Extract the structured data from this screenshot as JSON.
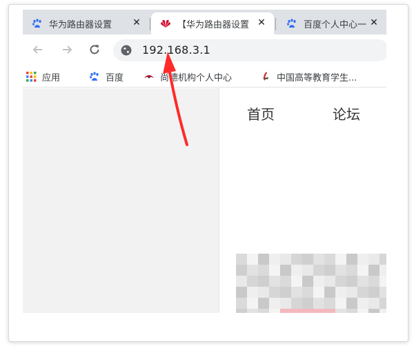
{
  "tabs": [
    {
      "title": "华为路由器设置",
      "icon": "baidu-paw-icon",
      "active": false
    },
    {
      "title": "【华为路由器设置",
      "icon": "huawei-logo-icon",
      "active": true
    },
    {
      "title": "百度个人中心一",
      "icon": "baidu-paw-icon",
      "active": false
    }
  ],
  "tab_close_glyph": "✕",
  "address_bar": {
    "url": "192.168.3.1",
    "icon": "globe-icon"
  },
  "bookmarks": [
    {
      "label": "应用",
      "icon": "apps-grid-icon"
    },
    {
      "label": "百度",
      "icon": "baidu-paw-icon"
    },
    {
      "label": "尚德机构个人中心",
      "icon": "sunlands-logo-icon"
    },
    {
      "label": "中国高等教育学生...",
      "icon": "chsi-logo-icon"
    }
  ],
  "page": {
    "nav": [
      {
        "label": "首页"
      },
      {
        "label": "论坛"
      }
    ]
  },
  "annotation": {
    "icon": "red-arrow-icon",
    "color": "#ff2a2a"
  },
  "colors": {
    "tabstrip": "#dee1e6",
    "omnibox": "#f1f3f4",
    "baidu_blue": "#2f6ef5",
    "huawei_red": "#cf0a2c"
  }
}
